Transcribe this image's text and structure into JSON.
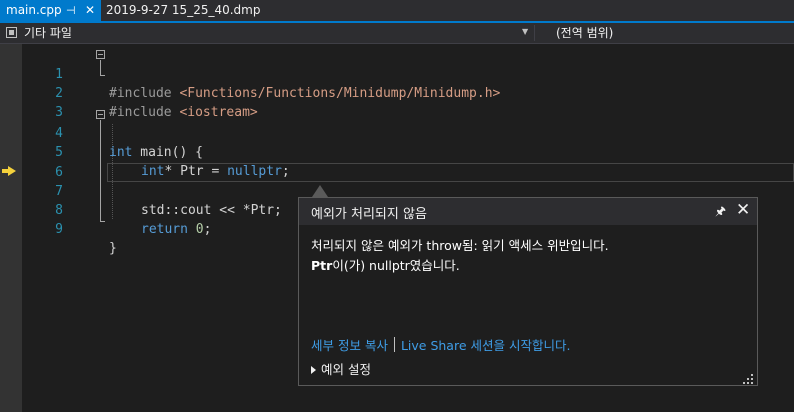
{
  "tabs": {
    "active_label": "main.cpp",
    "pin_glyph": "⊣",
    "close_glyph": "✕",
    "inactive_label": "2019-9-27 15_25_40.dmp"
  },
  "navbar": {
    "scope_label": "기타 파일",
    "member_label": "(전역 범위)"
  },
  "editor": {
    "line_numbers": [
      "1",
      "2",
      "3",
      "4",
      "5",
      "6",
      "7",
      "8",
      "9"
    ],
    "lines": {
      "l1_directive": "#include ",
      "l1_path": "<Functions/Functions/Minidump/Minidump.h>",
      "l2_directive": "#include ",
      "l2_path": "<iostream>",
      "l4_kw": "int",
      "l4_rest": " main() {",
      "l5_kw": "int",
      "l5_mid": "* Ptr = ",
      "l5_kw2": "nullptr",
      "l5_end": ";",
      "l7": "std::cout << *Ptr;",
      "l8_kw": "return",
      "l8_sp": " ",
      "l8_num": "0",
      "l8_end": ";",
      "l9": "}"
    }
  },
  "exception_popup": {
    "title": "예외가 처리되지 않음",
    "message_line1": "처리되지 않은 예외가 throw됨: 읽기 액세스 위반입니다.",
    "message_bold": "Ptr",
    "message_line2_rest": "이(가) nullptr였습니다.",
    "link_copy_details": "세부 정보 복사",
    "link_live_share": "Live Share 세션을 시작합니다.",
    "settings_label": "예외 설정"
  }
}
